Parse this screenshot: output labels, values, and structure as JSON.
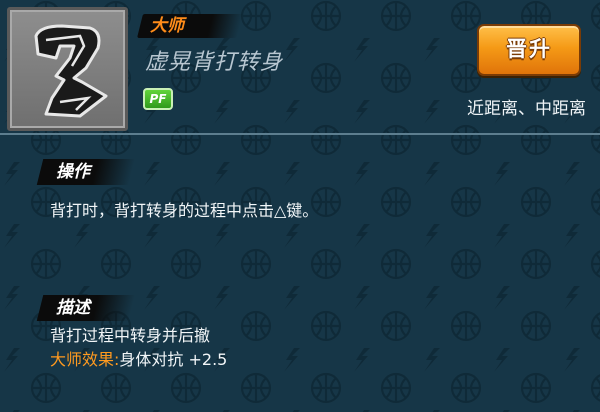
{
  "skill": {
    "rank": "大师",
    "name": "虚晃背打转身",
    "position_badge": "PF",
    "upgrade_label": "晋升",
    "range": "近距离、中距离"
  },
  "operation": {
    "label": "操作",
    "text": "背打时，背打转身的过程中点击△键。"
  },
  "description": {
    "label": "描述",
    "text": "背打过程中转身并后撤",
    "effect_label": "大师效果:",
    "effect_value": "身体对抗 +2.5"
  },
  "colors": {
    "background": "#163647",
    "rank": "#ff8c1a",
    "effect_label": "#ff9a1f",
    "button": "#f59a16",
    "badge_green": "#3fb423"
  },
  "icons": {
    "skill_icon": "back-turn-move-icon",
    "background_pattern": "basketball-lightning-pattern"
  }
}
